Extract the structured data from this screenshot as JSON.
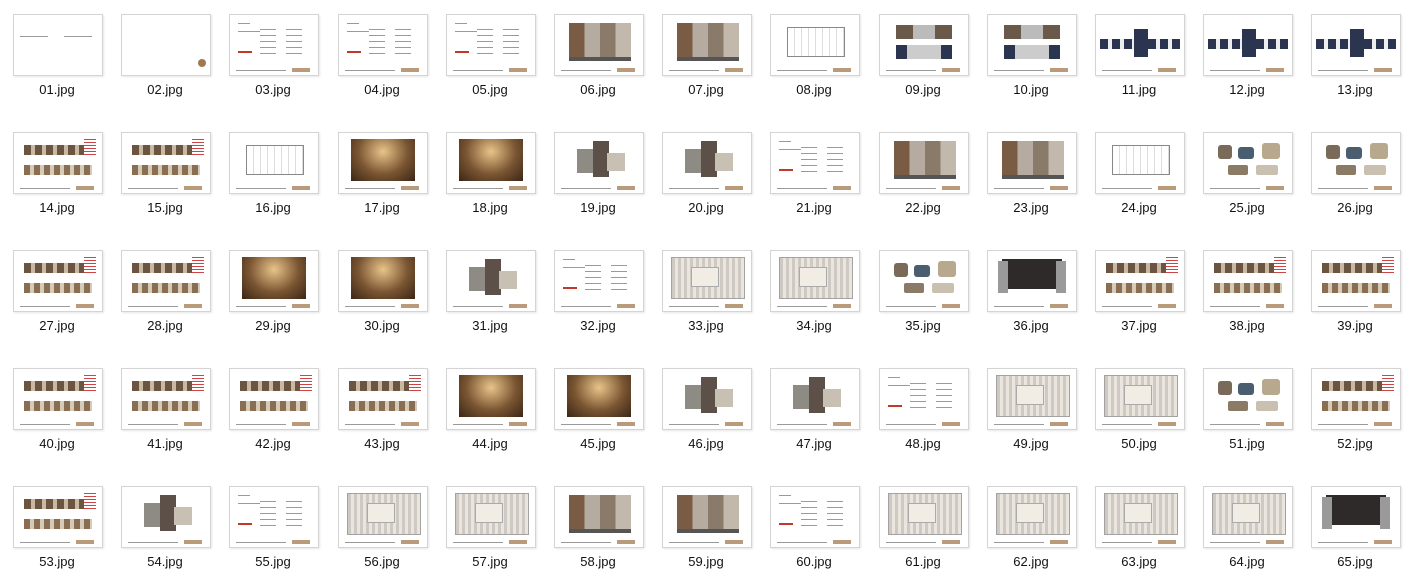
{
  "files": [
    {
      "name": "01.jpg",
      "kind": "cover"
    },
    {
      "name": "02.jpg",
      "kind": "logo"
    },
    {
      "name": "03.jpg",
      "kind": "toc"
    },
    {
      "name": "04.jpg",
      "kind": "toc"
    },
    {
      "name": "05.jpg",
      "kind": "toc"
    },
    {
      "name": "06.jpg",
      "kind": "elev"
    },
    {
      "name": "07.jpg",
      "kind": "elev"
    },
    {
      "name": "08.jpg",
      "kind": "drawing"
    },
    {
      "name": "09.jpg",
      "kind": "section"
    },
    {
      "name": "10.jpg",
      "kind": "section"
    },
    {
      "name": "11.jpg",
      "kind": "wide"
    },
    {
      "name": "12.jpg",
      "kind": "wide"
    },
    {
      "name": "13.jpg",
      "kind": "wide"
    },
    {
      "name": "14.jpg",
      "kind": "strips"
    },
    {
      "name": "15.jpg",
      "kind": "strips"
    },
    {
      "name": "16.jpg",
      "kind": "drawing"
    },
    {
      "name": "17.jpg",
      "kind": "render"
    },
    {
      "name": "18.jpg",
      "kind": "render"
    },
    {
      "name": "19.jpg",
      "kind": "swatch"
    },
    {
      "name": "20.jpg",
      "kind": "swatch"
    },
    {
      "name": "21.jpg",
      "kind": "toc"
    },
    {
      "name": "22.jpg",
      "kind": "elev"
    },
    {
      "name": "23.jpg",
      "kind": "elev"
    },
    {
      "name": "24.jpg",
      "kind": "drawing"
    },
    {
      "name": "25.jpg",
      "kind": "furniture"
    },
    {
      "name": "26.jpg",
      "kind": "furniture"
    },
    {
      "name": "27.jpg",
      "kind": "strips"
    },
    {
      "name": "28.jpg",
      "kind": "strips"
    },
    {
      "name": "29.jpg",
      "kind": "render"
    },
    {
      "name": "30.jpg",
      "kind": "render"
    },
    {
      "name": "31.jpg",
      "kind": "swatch"
    },
    {
      "name": "32.jpg",
      "kind": "toc"
    },
    {
      "name": "33.jpg",
      "kind": "plan"
    },
    {
      "name": "34.jpg",
      "kind": "plan"
    },
    {
      "name": "35.jpg",
      "kind": "furniture"
    },
    {
      "name": "36.jpg",
      "kind": "dark"
    },
    {
      "name": "37.jpg",
      "kind": "strips"
    },
    {
      "name": "38.jpg",
      "kind": "strips"
    },
    {
      "name": "39.jpg",
      "kind": "strips"
    },
    {
      "name": "40.jpg",
      "kind": "strips"
    },
    {
      "name": "41.jpg",
      "kind": "strips"
    },
    {
      "name": "42.jpg",
      "kind": "strips"
    },
    {
      "name": "43.jpg",
      "kind": "strips"
    },
    {
      "name": "44.jpg",
      "kind": "render"
    },
    {
      "name": "45.jpg",
      "kind": "render"
    },
    {
      "name": "46.jpg",
      "kind": "swatch"
    },
    {
      "name": "47.jpg",
      "kind": "swatch"
    },
    {
      "name": "48.jpg",
      "kind": "toc"
    },
    {
      "name": "49.jpg",
      "kind": "plan"
    },
    {
      "name": "50.jpg",
      "kind": "plan"
    },
    {
      "name": "51.jpg",
      "kind": "furniture"
    },
    {
      "name": "52.jpg",
      "kind": "strips"
    },
    {
      "name": "53.jpg",
      "kind": "strips"
    },
    {
      "name": "54.jpg",
      "kind": "swatch"
    },
    {
      "name": "55.jpg",
      "kind": "toc"
    },
    {
      "name": "56.jpg",
      "kind": "plan"
    },
    {
      "name": "57.jpg",
      "kind": "plan"
    },
    {
      "name": "58.jpg",
      "kind": "elev"
    },
    {
      "name": "59.jpg",
      "kind": "elev"
    },
    {
      "name": "60.jpg",
      "kind": "toc"
    },
    {
      "name": "61.jpg",
      "kind": "plan"
    },
    {
      "name": "62.jpg",
      "kind": "plan"
    },
    {
      "name": "63.jpg",
      "kind": "plan"
    },
    {
      "name": "64.jpg",
      "kind": "plan"
    },
    {
      "name": "65.jpg",
      "kind": "dark"
    }
  ],
  "colors": {
    "label": "#111111",
    "thumb_border": "#d4d4d4",
    "wood": "#8a6a4a",
    "dark": "#2e2a2a",
    "warm_render": "#7a5532",
    "navy": "#2c3550",
    "stone": "#c8c0b2",
    "accent_red": "#c0392b"
  }
}
